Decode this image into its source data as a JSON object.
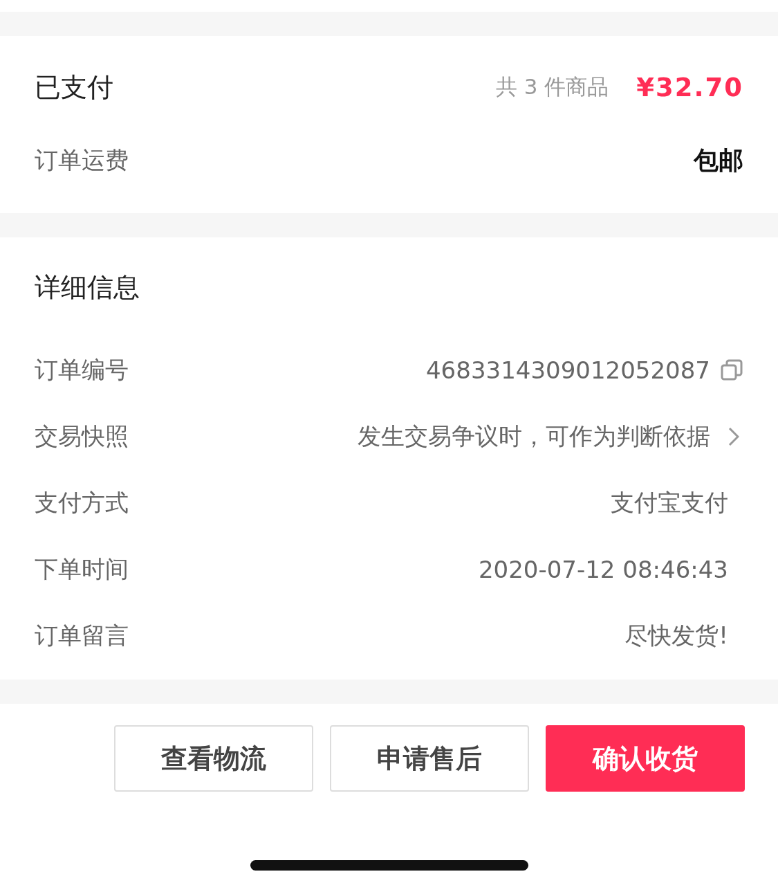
{
  "payment": {
    "status": "已支付",
    "count": "共 3 件商品",
    "total": "¥32.70",
    "shipping_label": "订单运费",
    "shipping_value": "包邮"
  },
  "details": {
    "title": "详细信息",
    "rows": [
      {
        "label": "订单编号",
        "value": "4683314309012052087",
        "kind": "copy"
      },
      {
        "label": "交易快照",
        "value": "发生交易争议时，可作为判断依据",
        "kind": "link"
      },
      {
        "label": "支付方式",
        "value": "支付宝支付",
        "kind": "plain"
      },
      {
        "label": "下单时间",
        "value": "2020-07-12 08:46:43",
        "kind": "plain"
      },
      {
        "label": "订单留言",
        "value": "尽快发货!",
        "kind": "plain"
      }
    ]
  },
  "actions": [
    {
      "label": "查看物流",
      "primary": false
    },
    {
      "label": "申请售后",
      "primary": false
    },
    {
      "label": "确认收货",
      "primary": true
    }
  ]
}
